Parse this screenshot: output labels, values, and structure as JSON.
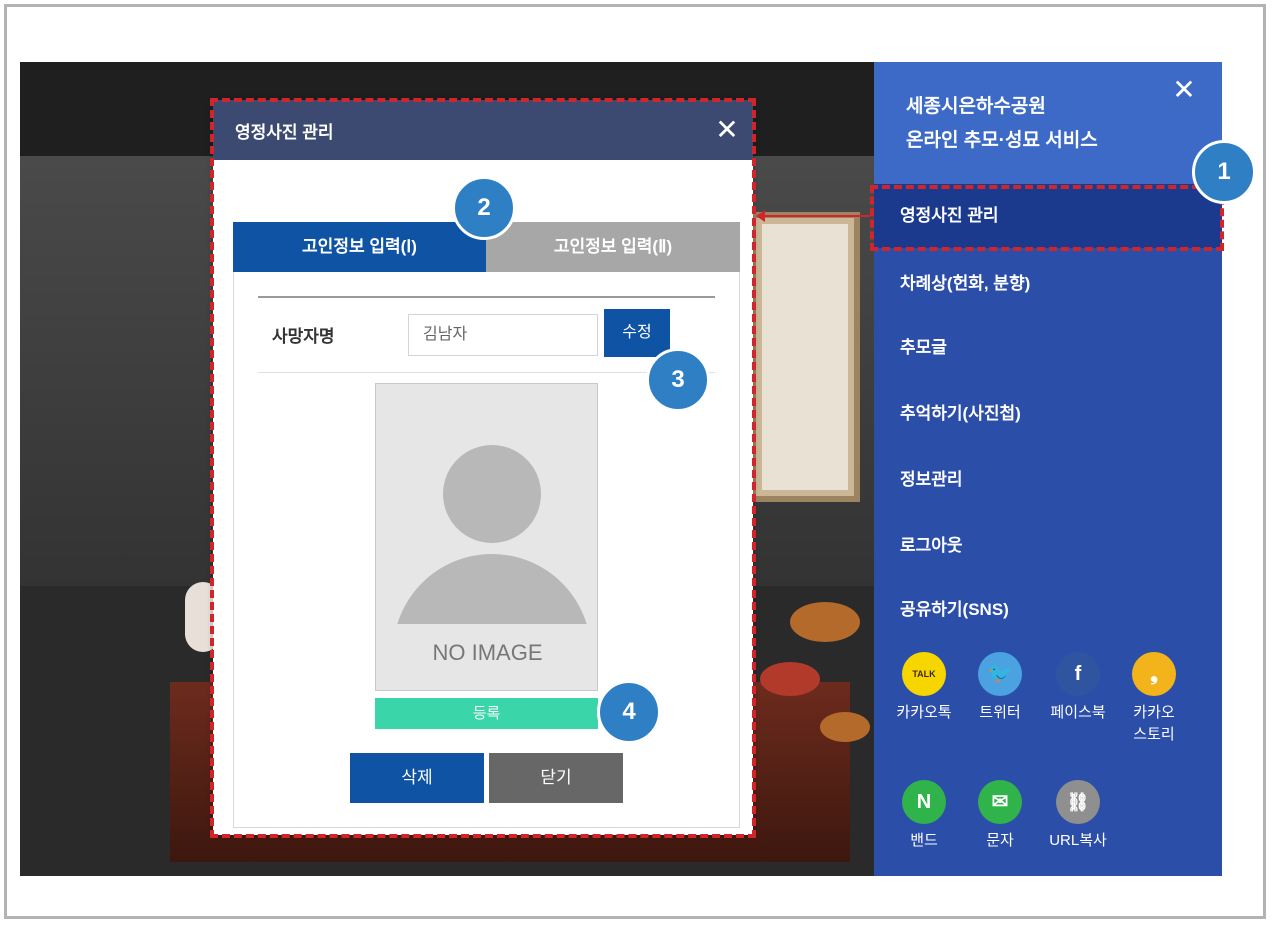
{
  "modal": {
    "title": "영정사진 관리",
    "tabs": [
      "고인정보 입력(Ⅰ)",
      "고인정보 입력(Ⅱ)"
    ],
    "name_label": "사망자명",
    "name_value": "김남자",
    "edit_label": "수정",
    "no_image": "NO IMAGE",
    "register_label": "등록",
    "delete_label": "삭제",
    "close_label": "닫기"
  },
  "side": {
    "title_line1": "세종시은하수공원",
    "title_line2": "온라인 추모·성묘 서비스",
    "menu": [
      "영정사진 관리",
      "차례상(헌화, 분향)",
      "추모글",
      "추억하기(사진첩)",
      "정보관리",
      "로그아웃",
      "공유하기(SNS)"
    ],
    "share": [
      {
        "label": "카카오톡",
        "icon": "kakaotalk-icon",
        "color": "#f7d600",
        "glyph": "TALK"
      },
      {
        "label": "트위터",
        "icon": "twitter-icon",
        "color": "#4aa3e0",
        "glyph": "t"
      },
      {
        "label": "페이스북",
        "icon": "facebook-icon",
        "color": "#2f55a0",
        "glyph": "f"
      },
      {
        "label": "카카오\n스토리",
        "icon": "kakaostory-icon",
        "color": "#f3b31b",
        "glyph": "❟"
      },
      {
        "label": "밴드",
        "icon": "band-icon",
        "color": "#2fb34a",
        "glyph": "N"
      },
      {
        "label": "문자",
        "icon": "message-icon",
        "color": "#2fb34a",
        "glyph": "✉"
      },
      {
        "label": "URL복사",
        "icon": "link-icon",
        "color": "#8f8f8f",
        "glyph": "🔗"
      }
    ]
  },
  "badges": [
    "1",
    "2",
    "3",
    "4"
  ],
  "colors": {
    "accent": "#0f53a5",
    "menu_bg": "#2b4ea8",
    "menu_header": "#3c6ac6",
    "annotation": "#d0262b",
    "register": "#3ad6aa"
  }
}
